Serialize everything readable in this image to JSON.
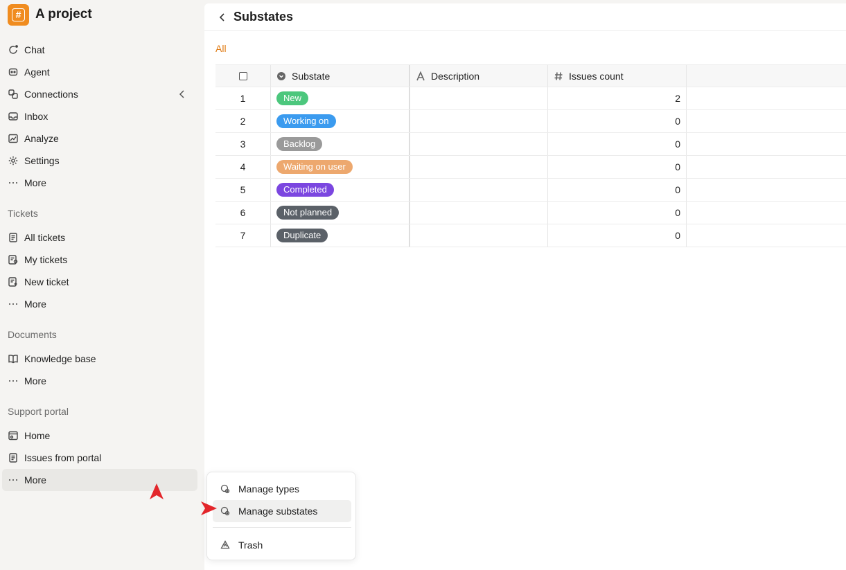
{
  "project": {
    "title": "A project",
    "logo_glyph": "#",
    "accent": "#f08c1f"
  },
  "sidebar": {
    "primary": [
      {
        "label": "Chat",
        "icon": "chat-icon"
      },
      {
        "label": "Agent",
        "icon": "agent-icon"
      },
      {
        "label": "Connections",
        "icon": "connections-icon"
      },
      {
        "label": "Inbox",
        "icon": "inbox-icon"
      },
      {
        "label": "Analyze",
        "icon": "analyze-icon"
      },
      {
        "label": "Settings",
        "icon": "settings-icon"
      },
      {
        "label": "More",
        "icon": "more-icon"
      }
    ],
    "tickets": {
      "title": "Tickets",
      "items": [
        {
          "label": "All tickets",
          "icon": "tickets-icon"
        },
        {
          "label": "My tickets",
          "icon": "my-tickets-icon"
        },
        {
          "label": "New ticket",
          "icon": "new-ticket-icon"
        },
        {
          "label": "More",
          "icon": "more-icon"
        }
      ]
    },
    "documents": {
      "title": "Documents",
      "items": [
        {
          "label": "Knowledge base",
          "icon": "book-icon"
        },
        {
          "label": "More",
          "icon": "more-icon"
        }
      ]
    },
    "portal": {
      "title": "Support portal",
      "items": [
        {
          "label": "Home",
          "icon": "home-icon"
        },
        {
          "label": "Issues from portal",
          "icon": "tickets-icon"
        },
        {
          "label": "More",
          "icon": "more-icon"
        }
      ]
    }
  },
  "main": {
    "title": "Substates",
    "tab": "All",
    "columns": {
      "substate": "Substate",
      "description": "Description",
      "count": "Issues count"
    },
    "rows": [
      {
        "index": "1",
        "substate": "New",
        "color": "#4cc77d",
        "description": "",
        "count": "2"
      },
      {
        "index": "2",
        "substate": "Working on",
        "color": "#3b9bef",
        "description": "",
        "count": "0"
      },
      {
        "index": "3",
        "substate": "Backlog",
        "color": "#9a9a9a",
        "description": "",
        "count": "0"
      },
      {
        "index": "4",
        "substate": "Waiting on user",
        "color": "#eda86e",
        "description": "",
        "count": "0"
      },
      {
        "index": "5",
        "substate": "Completed",
        "color": "#7b46e0",
        "description": "",
        "count": "0"
      },
      {
        "index": "6",
        "substate": "Not planned",
        "color": "#5b6168",
        "description": "",
        "count": "0"
      },
      {
        "index": "7",
        "substate": "Duplicate",
        "color": "#5b6168",
        "description": "",
        "count": "0"
      }
    ]
  },
  "menu": {
    "items": [
      {
        "label": "Manage types",
        "icon": "manage-icon"
      },
      {
        "label": "Manage substates",
        "icon": "manage-icon"
      },
      {
        "label": "Trash",
        "icon": "trash-icon"
      }
    ]
  }
}
